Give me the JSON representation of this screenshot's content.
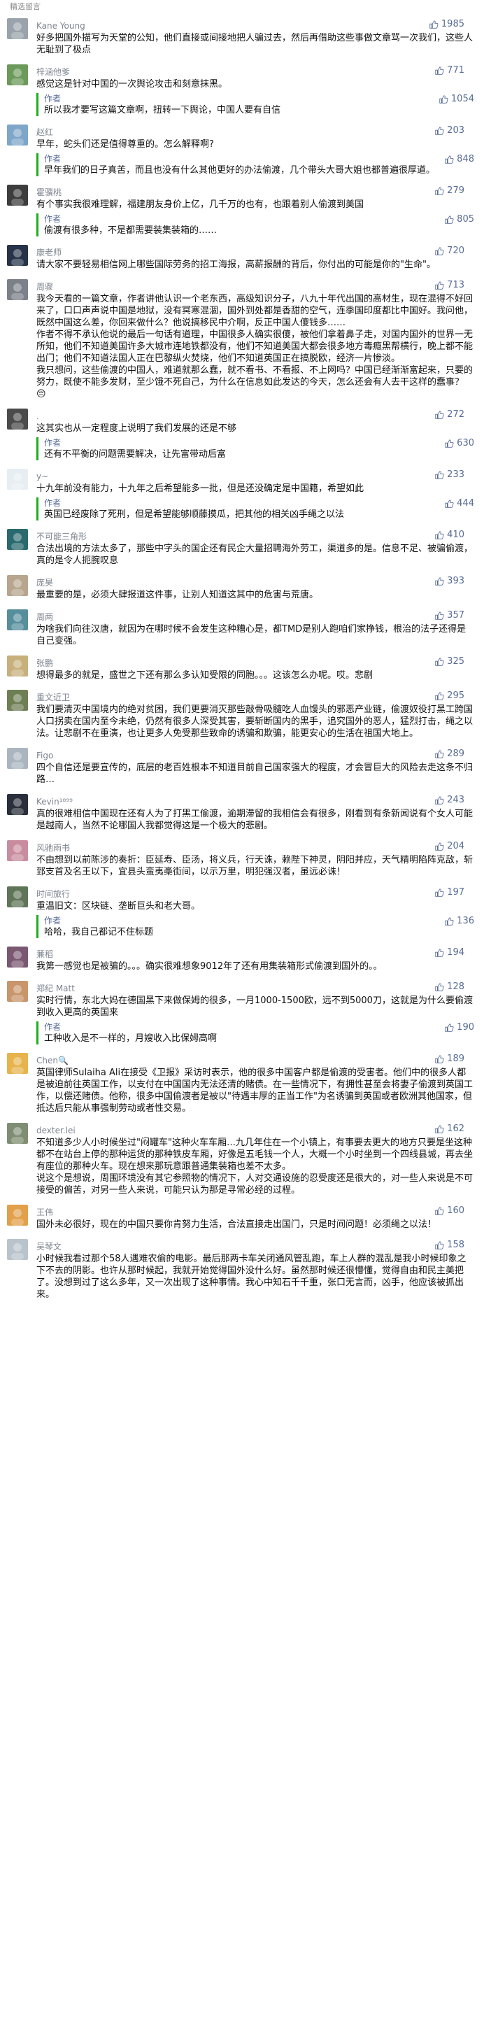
{
  "section_title": "精选留言",
  "comments": [
    {
      "name": "Kane Young",
      "likes": "1985",
      "text": "好多把国外描写为天堂的公知，他们直接或间接地把人骗过去，然后再借助这些事做文章骂一次我们，这些人无耻到了极点",
      "avatar": "gray"
    },
    {
      "name": "梓涵他爹",
      "likes": "771",
      "text": "感觉这是针对中国的一次舆论攻击和刻意抹黑。",
      "avatar": "green",
      "reply": {
        "label": "作者",
        "likes": "1054",
        "text": "所以我才要写这篇文章啊，扭转一下舆论，中国人要有自信"
      }
    },
    {
      "name": "赵红",
      "likes": "203",
      "text": "早年，蛇头们还是值得尊重的。怎么解释啊?",
      "avatar": "blue",
      "reply": {
        "label": "作者",
        "likes": "848",
        "text": "早年我们的日子真苦，而且也没有什么其他更好的办法偷渡，几个带头大哥大姐也都普遍很厚道。"
      }
    },
    {
      "name": "霍骥桃",
      "likes": "279",
      "text": "有个事实我很难理解，福建朋友身价上亿，几千万的也有，也跟着别人偷渡到美国",
      "avatar": "dark",
      "reply": {
        "label": "作者",
        "likes": "805",
        "text": "偷渡有很多种，不是都需要装集装箱的……"
      }
    },
    {
      "name": "康老师",
      "likes": "720",
      "text": "请大家不要轻易相信网上哪些国际劳务的招工海报，高薪报酬的背后，你付出的可能是你的\"生命\"。",
      "avatar": "navy"
    },
    {
      "name": "周骤",
      "likes": "713",
      "text": "我今天看的一篇文章，作者讲他认识一个老东西，高级知识分子，八九十年代出国的高材生，现在混得不好回来了，口口声声说中国是地狱，没有冥寒混涸，国外到处都是香甜的空气，连季国印度都比中国好。我问他，既然中国这么差，你回来做什么？他说搞移民中介啊，反正中国人傻钱多……\n作者不得不承认他说的最后一句话有道理，中国很多人确实很傻，被他们拿着鼻子走，对国内国外的世界一无所知，他们不知道美国许多大城市连地铁都没有，他们不知道美国大都会很多地方毒瘾黑帮横行，晚上都不能出门；他们不知道法国人正在巴黎纵火焚烧，他们不知道英国正在搞脱欧，经济一片惨淡。\n我只想问，这些偷渡的中国人，难道就那么蠢，就不看书、不看报、不上网吗？中国已经渐渐富起来，只要的努力，既使不能多发财，至少饿不死自己，为什么在信息如此发达的今天，怎么还会有人去干这样的蠢事？ 😔",
      "avatar": "slate"
    },
    {
      "name": ".",
      "likes": "272",
      "text": "这其实也从一定程度上说明了我们发展的还是不够",
      "avatar": "pattern",
      "reply": {
        "label": "作者",
        "likes": "630",
        "text": "还有不平衡的问题需要解决，让先富带动后富"
      }
    },
    {
      "name": "y~",
      "likes": "233",
      "text": "十九年前没有能力，十九年之后希望能多一批，但是还没确定是中国籍，希望如此",
      "avatar": "light",
      "reply": {
        "label": "作者",
        "likes": "444",
        "text": "英国已经废除了死刑，但是希望能够顺藤摸瓜，把其他的相关凶手绳之以法"
      }
    },
    {
      "name": "不可能三角形",
      "likes": "410",
      "text": "合法出境的方法太多了，那些中字头的国企还有民企大量招聘海外劳工，渠道多的是。信息不足、被骗偷渡，真的是令人扼腕叹息",
      "avatar": "teal"
    },
    {
      "name": "庞昊",
      "likes": "393",
      "text": "最重要的是，必须大肆报道这件事，让别人知道这其中的危害与荒唐。",
      "avatar": "stone"
    },
    {
      "name": "周两",
      "likes": "357",
      "text": "为啥我们向往汉唐，就因为在哪时候不会发生这种糟心是，都TMD是别人跑咱们家挣钱，根治的法子还得是自己变强。",
      "avatar": "teal2"
    },
    {
      "name": "张鹏",
      "likes": "325",
      "text": "想得最多的就是，盛世之下还有那么多认知受限的同胞。。。这该怎么办呢。哎。悲剧",
      "avatar": "sand"
    },
    {
      "name": "重文近卫",
      "likes": "295",
      "text": "我们要清灭中国境内的绝对贫困，我们更要消灭那些敲骨吸髓吃人血馒头的邪恶产业链，偷渡奴役打黑工跨国人口拐卖在国内至今未绝，仍然有很多人深受其害，要斩断国内的黑手，追究国外的恶人，猛烈打击，绳之以法。让悲剧不在重演，也让更多人免受那些致命的诱骗和欺骗，能更安心的生活在祖国大地上。",
      "avatar": "olive"
    },
    {
      "name": "Figo",
      "likes": "289",
      "text": "四个自信还是要宣传的，底层的老百姓根本不知道目前自己国家强大的程度，才会冒巨大的风险去走这条不归路…",
      "avatar": "mist"
    },
    {
      "name": "Kevin¹⁸⁹⁹",
      "likes": "243",
      "text": "真的很难相信中国现在还有人为了打黑工偷渡，逾期滞留的我相信会有很多，刚看到有条新闻说有个女人可能是越南人，当然不论哪国人我都觉得这是一个极大的悲剧。",
      "avatar": "night"
    },
    {
      "name": "风驰雨书",
      "likes": "204",
      "text": "不由想到以前陈涉的奏折：臣延寿、臣汤，将义兵，行天诛，赖陛下神灵，阴阳并应，天气精明陷阵克敌，斩郅支首及名王以下，宜县头蛮夷槀街间，以示万里，明犯强汉者，虽远必诛！",
      "avatar": "pink"
    },
    {
      "name": "时间旅行",
      "likes": "197",
      "text": "重温旧文：区块链、垄断巨头和老大哥。",
      "avatar": "moss",
      "reply": {
        "label": "作者",
        "likes": "136",
        "text": "哈哈，我自己都记不住标题"
      }
    },
    {
      "name": "蒹稻",
      "likes": "194",
      "text": "我第一感觉也是被骗的。。。确实很难想象9012年了还有用集装箱形式偷渡到国外的。。",
      "avatar": "plum"
    },
    {
      "name": "郑纪 Matt",
      "likes": "128",
      "text": "实时行情，东北大妈在德国黑下来做保姆的很多，一月1000-1500欧，远不到5000刀，这就是为什么要偷渡到收入更高的英国来",
      "avatar": "warm",
      "reply": {
        "label": "作者",
        "likes": "190",
        "text": "工种收入是不一样的，月嫂收入比保姆高啊"
      }
    },
    {
      "name": "Chen🔍",
      "likes": "189",
      "text": "英国律师Sulaiha Ali在接受《卫报》采访时表示，他的很多中国客户都是偷渡的受害者。他们中的很多人都是被迫前往英国工作，以支付在中国国内无法还清的赌债。在一些情况下，有拥性甚至会将妻子偷渡到英国工作，以偿还赌债。他称，很多中国偷渡者是被以\"待遇丰厚的正当工作\"为名诱骗到英国或者欧洲其他国家，但抵达后只能从事强制劳动或者性交易。",
      "avatar": "sun"
    },
    {
      "name": "dexter.lei",
      "likes": "162",
      "text": "不知道多少人小时候坐过\"闷罐车\"这种火车车厢…九几年住在一个小镇上，有事要去更大的地方只要是坐这种都不在站台上停的那种运货的那种铁皮车厢，好像是五毛钱一个人，大概一个小时坐到一个四线县城，再去坐有座位的那种火车。现在想来那玩意跟普通集装箱也差不太多。\n说这个是想说，周围环境没有其它参照物的情况下，人对交通设施的忍受度还是很大的，对一些人来说是不可接受的偏苦，对另一些人来说，可能只认为那是寻常必经的过程。",
      "avatar": "hill"
    },
    {
      "name": "王伟",
      "likes": "160",
      "text": "国外未必很好，现在的中国只要你肯努力生活，合法直接走出国门，只是时间问题！必须绳之以法！",
      "avatar": "cartoon"
    },
    {
      "name": "吴琴文",
      "likes": "158",
      "text": "小时候我看过那个58人遇难农偷的电影。最后那两卡车关闭通风管乱跑，车上人群的混乱是我小时候印象之下不去的阴影。也许从那时候起，我就开始觉得国外没什么好。虽然那时候还很懵懂，觉得自由和民主美把了。没想到过了这么多年，又一次出现了这种事情。我心中知石千千重，张口无言而，凶手，他应该被抓出来。",
      "avatar": "fog"
    }
  ]
}
